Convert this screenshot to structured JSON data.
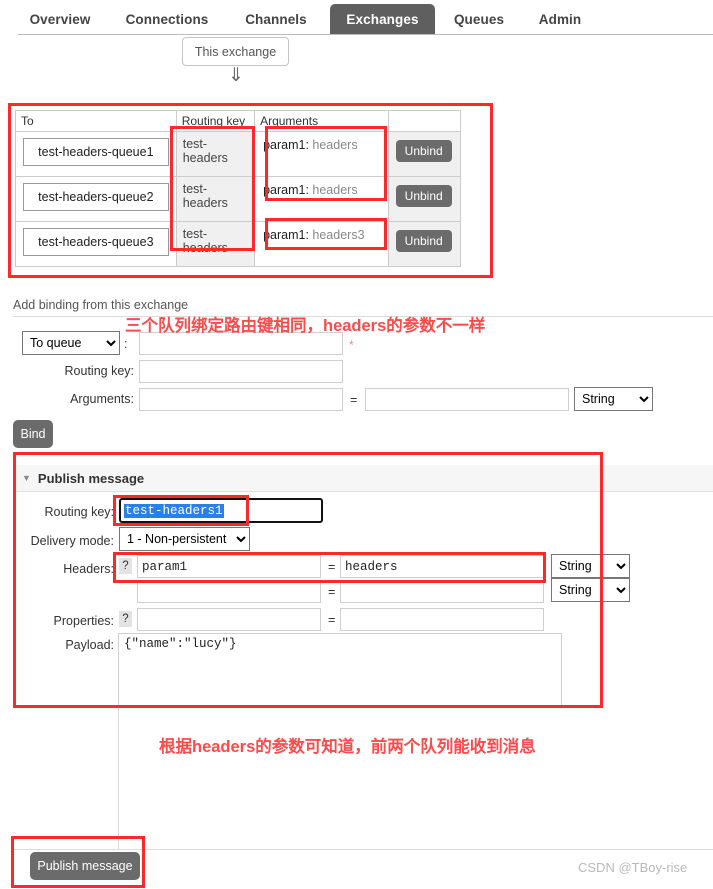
{
  "nav": {
    "tabs": [
      {
        "label": "Overview",
        "active": false
      },
      {
        "label": "Connections",
        "active": false
      },
      {
        "label": "Channels",
        "active": false
      },
      {
        "label": "Exchanges",
        "active": true
      },
      {
        "label": "Queues",
        "active": false
      },
      {
        "label": "Admin",
        "active": false
      }
    ],
    "subtab": "This exchange",
    "down_arrow_icon": "double-down-arrow"
  },
  "bindings": {
    "headers": [
      "To",
      "Routing key",
      "Arguments",
      ""
    ],
    "rows": [
      {
        "to": "test-headers-queue1",
        "routing_key": "test-headers",
        "arg_key": "param1:",
        "arg_val": "headers",
        "action": "Unbind"
      },
      {
        "to": "test-headers-queue2",
        "routing_key": "test-headers",
        "arg_key": "param1:",
        "arg_val": "headers",
        "action": "Unbind"
      },
      {
        "to": "test-headers-queue3",
        "routing_key": "test-headers",
        "arg_key": "param1:",
        "arg_val": "headers3",
        "action": "Unbind"
      }
    ]
  },
  "add_binding": {
    "section_title": "Add binding from this exchange",
    "destination_select": "To queue",
    "destination_colon": ":",
    "destination_value": "",
    "required_mark": "*",
    "routing_key_label": "Routing key:",
    "routing_key_value": "",
    "arguments_label": "Arguments:",
    "arguments_key": "",
    "arguments_equals": "=",
    "arguments_value": "",
    "arguments_type": "String",
    "bind_button": "Bind"
  },
  "publish": {
    "panel_title": "Publish message",
    "collapse_icon": "triangle-down-icon",
    "routing_key_label": "Routing key:",
    "routing_key_value": "test-headers1",
    "delivery_mode_label": "Delivery mode:",
    "delivery_mode_value": "1 - Non-persistent",
    "headers_label": "Headers:",
    "help_icon": "?",
    "header_rows": [
      {
        "key": "param1",
        "equals": "=",
        "value": "headers",
        "type": "String"
      },
      {
        "key": "",
        "equals": "=",
        "value": "",
        "type": "String"
      }
    ],
    "properties_label": "Properties:",
    "properties_key": "",
    "properties_equals": "=",
    "properties_value": "",
    "payload_label": "Payload:",
    "payload_value": "{\"name\":\"lucy\"}",
    "publish_button": "Publish message"
  },
  "annotations": {
    "note_top": "三个队列绑定路由键相同，headers的参数不一样",
    "note_bottom": "根据headers的参数可知道，前两个队列能收到消息"
  },
  "footer": {
    "watermark": "CSDN @TBoy-rise"
  },
  "colors": {
    "annotation_red": "#fb2a2a",
    "active_tab": "#605f5f",
    "button_gray": "#6b6b6b",
    "selection_blue": "#2a7fe8"
  }
}
